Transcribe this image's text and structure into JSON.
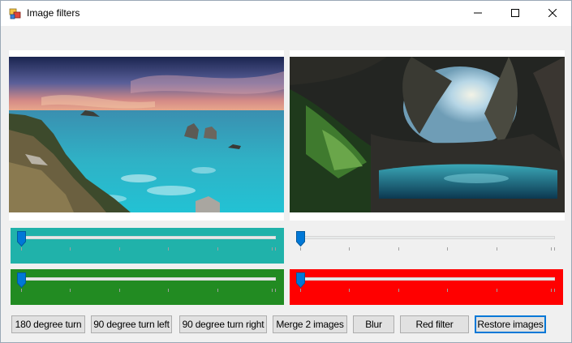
{
  "window": {
    "title": "Image filters",
    "controls": [
      "minimize-icon",
      "maximize-icon",
      "close-icon"
    ]
  },
  "images": [
    {
      "name": "coastal-sea-rocks",
      "description_icon": "image"
    },
    {
      "name": "sea-cave-lagoon",
      "description_icon": "image"
    }
  ],
  "sliders": [
    {
      "name": "teal-slider",
      "panel_color": "#20b2aa",
      "value": 0
    },
    {
      "name": "plain-slider",
      "panel_color": "#f0f0f0",
      "value": 0
    },
    {
      "name": "green-slider",
      "panel_color": "#228b22",
      "value": 0
    },
    {
      "name": "red-slider",
      "panel_color": "#ff0000",
      "value": 0
    }
  ],
  "buttons": {
    "turn180": "180 degree turn",
    "turn_left": "90 degree turn left",
    "turn_right": "90 degree turn right",
    "merge": "Merge 2 images",
    "blur": "Blur",
    "red_filter": "Red filter",
    "restore": "Restore images"
  },
  "colors": {
    "focus": "#0078d7",
    "thumb": "#0078d7"
  }
}
